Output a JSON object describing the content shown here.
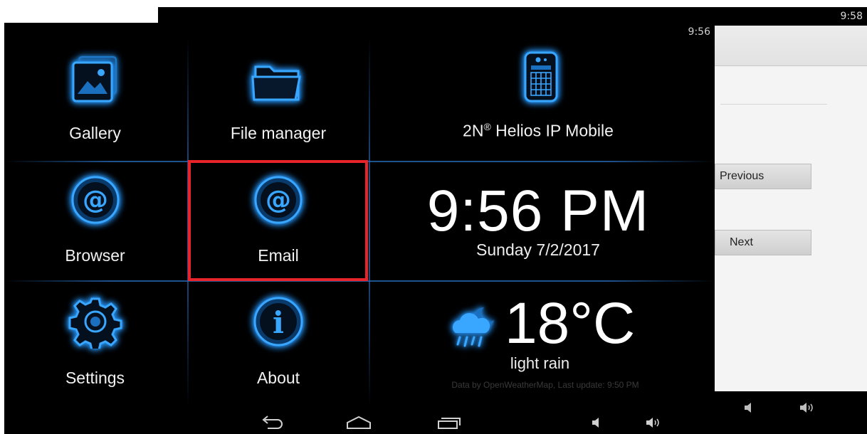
{
  "back_window": {
    "status_clock": "9:58",
    "buttons": {
      "previous": "Previous",
      "next": "Next"
    }
  },
  "front_window": {
    "status_clock": "9:56",
    "tiles": [
      {
        "label": "Gallery",
        "icon": "gallery-icon"
      },
      {
        "label": "File manager",
        "icon": "folder-icon"
      },
      {
        "label": "Browser",
        "icon": "at-sign-icon"
      },
      {
        "label": "Email",
        "icon": "at-sign-icon"
      },
      {
        "label": "Settings",
        "icon": "gear-icon"
      },
      {
        "label": "About",
        "icon": "info-icon"
      }
    ],
    "intercom": {
      "title_main": "2N",
      "title_mark": "®",
      "title_rest": " Helios IP Mobile",
      "icon": "intercom-phone-icon"
    },
    "clock_widget": {
      "time": "9:56 PM",
      "date": "Sunday 7/2/2017"
    },
    "weather_widget": {
      "temperature": "18°C",
      "condition": "light rain",
      "credit": "Data by OpenWeatherMap, Last update: 9:50 PM",
      "icon": "cloud-rain-moon-icon"
    },
    "navbar": [
      "back-icon",
      "home-icon",
      "recent-apps-icon",
      "volume-down-icon",
      "volume-up-icon"
    ],
    "accent_color": "#1a7fd8",
    "highlight_color": "#e8232a"
  }
}
